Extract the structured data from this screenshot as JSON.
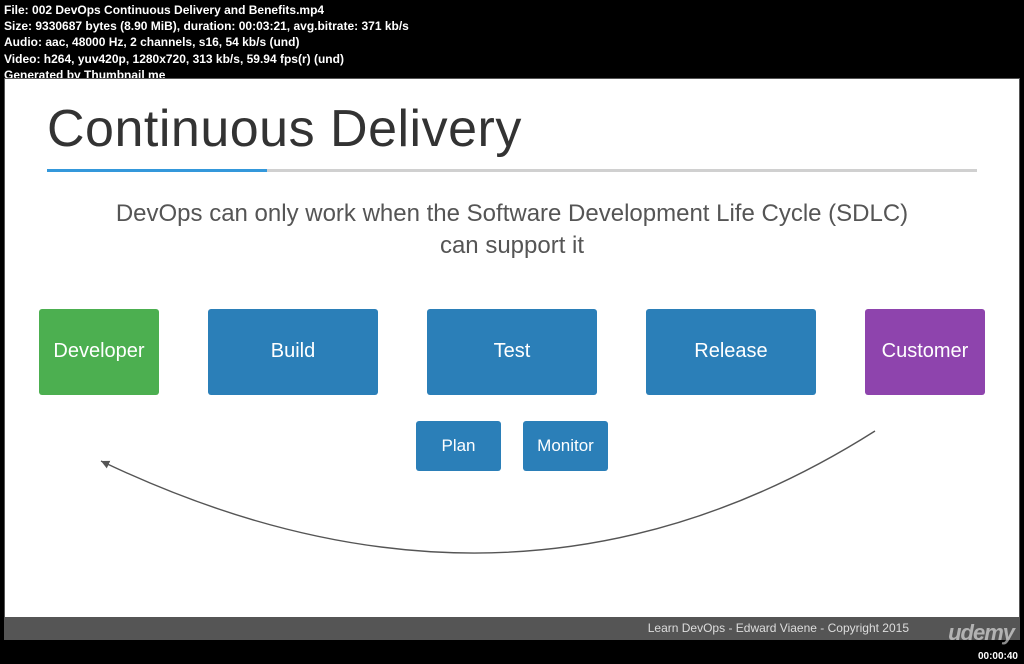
{
  "meta": {
    "file_label": "File:",
    "file_value": "002 DevOps Continuous Delivery and Benefits.mp4",
    "size_label": "Size:",
    "size_value": "9330687 bytes (8.90 MiB), duration: 00:03:21, avg.bitrate: 371 kb/s",
    "audio_label": "Audio:",
    "audio_value": "aac, 48000 Hz, 2 channels, s16, 54 kb/s (und)",
    "video_label": "Video:",
    "video_value": "h264, yuv420p, 1280x720, 313 kb/s, 59.94 fps(r) (und)",
    "generated": "Generated by Thumbnail me"
  },
  "slide": {
    "title": "Continuous Delivery",
    "subtitle": "DevOps can only work when the Software Development Life Cycle (SDLC) can support it",
    "boxes": {
      "developer": "Developer",
      "build": "Build",
      "test": "Test",
      "release": "Release",
      "customer": "Customer",
      "plan": "Plan",
      "monitor": "Monitor"
    },
    "footer": "Learn DevOps - Edward Viaene - Copyright 2015"
  },
  "brand": "udemy",
  "timestamp": "00:00:40"
}
